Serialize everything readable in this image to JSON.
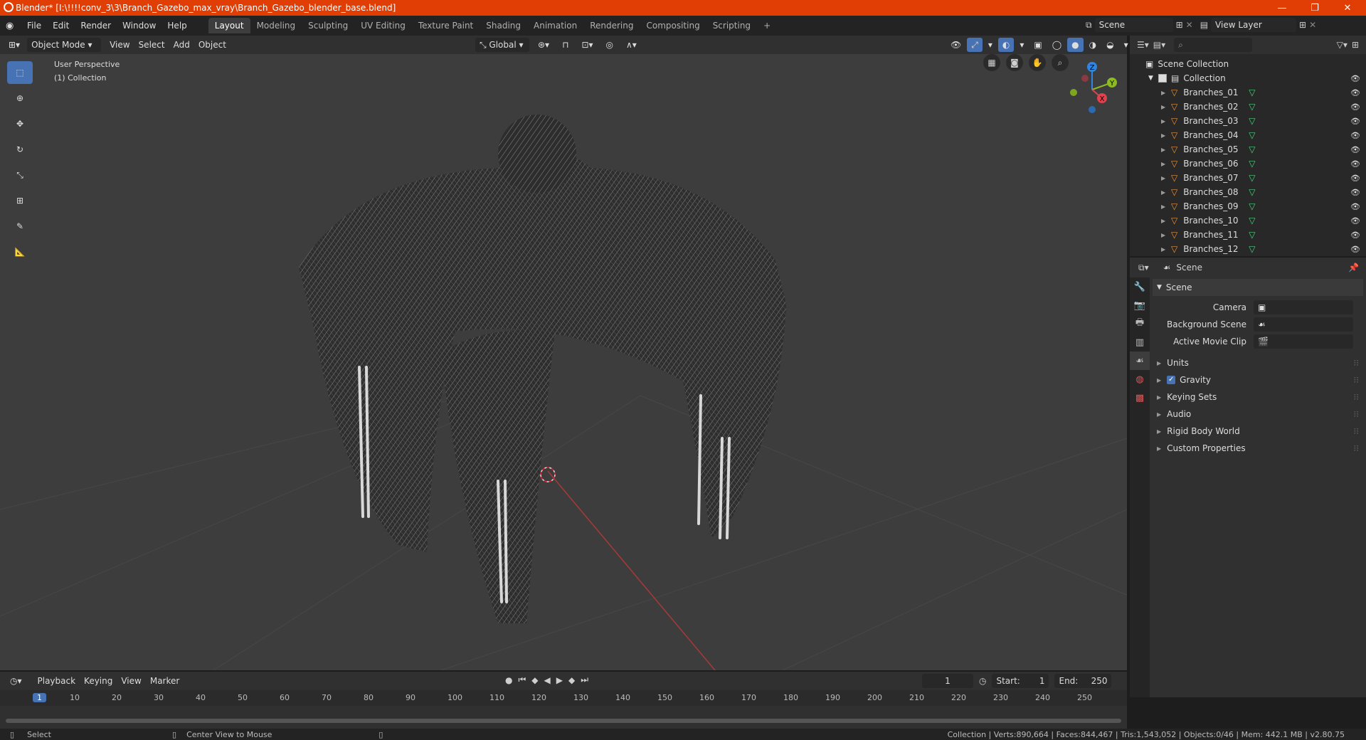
{
  "window": {
    "title": "Blender* [I:\\!!!!conv_3\\3\\Branch_Gazebo_max_vray\\Branch_Gazebo_blender_base.blend]",
    "minimize": "—",
    "restore": "❐",
    "close": "✕"
  },
  "menu": {
    "items": [
      "File",
      "Edit",
      "Render",
      "Window",
      "Help"
    ],
    "workspaces": [
      "Layout",
      "Modeling",
      "Sculpting",
      "UV Editing",
      "Texture Paint",
      "Shading",
      "Animation",
      "Rendering",
      "Compositing",
      "Scripting"
    ],
    "active_workspace": "Layout",
    "add_workspace": "+",
    "scene_label": "Scene",
    "view_layer_label": "View Layer"
  },
  "viewport_header": {
    "mode": "Object Mode",
    "menus": [
      "View",
      "Select",
      "Add",
      "Object"
    ],
    "orientation": "Global"
  },
  "viewport": {
    "perspective": "User Perspective",
    "collection": "(1) Collection",
    "gizmo": {
      "z": "Z",
      "y": "Y",
      "x": "X"
    }
  },
  "outliner": {
    "root": "Scene Collection",
    "collection": "Collection",
    "items": [
      "Branches_01",
      "Branches_02",
      "Branches_03",
      "Branches_04",
      "Branches_05",
      "Branches_06",
      "Branches_07",
      "Branches_08",
      "Branches_09",
      "Branches_10",
      "Branches_11",
      "Branches_12"
    ]
  },
  "properties": {
    "context": "Scene",
    "panel_title": "Scene",
    "fields": [
      {
        "label": "Camera",
        "value": ""
      },
      {
        "label": "Background Scene",
        "value": ""
      },
      {
        "label": "Active Movie Clip",
        "value": ""
      }
    ],
    "subpanels": [
      {
        "label": "Units",
        "checkbox": false
      },
      {
        "label": "Gravity",
        "checkbox": true
      },
      {
        "label": "Keying Sets",
        "checkbox": false
      },
      {
        "label": "Audio",
        "checkbox": false
      },
      {
        "label": "Rigid Body World",
        "checkbox": false
      },
      {
        "label": "Custom Properties",
        "checkbox": false
      }
    ]
  },
  "timeline": {
    "menus": [
      "Playback",
      "Keying",
      "View",
      "Marker"
    ],
    "current_frame": "1",
    "start_label": "Start:",
    "start": "1",
    "end_label": "End:",
    "end": "250",
    "ruler": [
      "1",
      "10",
      "20",
      "30",
      "40",
      "50",
      "60",
      "70",
      "80",
      "90",
      "100",
      "110",
      "120",
      "130",
      "140",
      "150",
      "160",
      "170",
      "180",
      "190",
      "200",
      "210",
      "220",
      "230",
      "240",
      "250"
    ]
  },
  "statusbar": {
    "left": "Select",
    "middle": "Center View to Mouse",
    "right": "Collection | Verts:890,664 | Faces:844,467 | Tris:1,543,052 | Objects:0/46 | Mem: 442.1 MB | v2.80.75"
  },
  "colors": {
    "titlebar": "#e03e05",
    "accent": "#4772b3",
    "mesh_icon": "#e8913c",
    "data_icon": "#4cd07d",
    "axis_x": "#e0424e",
    "axis_y": "#8cbb23",
    "axis_z": "#2f86e0"
  }
}
